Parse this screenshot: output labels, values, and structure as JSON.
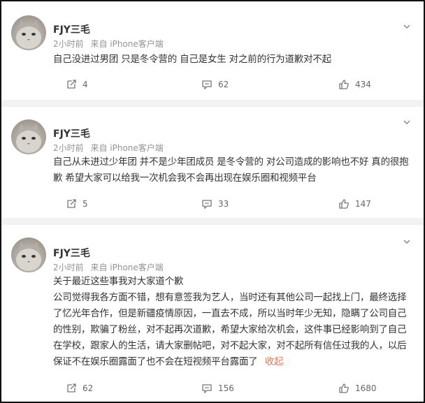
{
  "comments": [
    {
      "author": "FJY三毛",
      "time": "2小时前",
      "source": "来自 iPhone客户端",
      "lines": [
        "自己没进过男团 只是冬令营的 自己是女生 对之前的行为道歉对不起"
      ],
      "reposts": "4",
      "replies": "62",
      "likes": "434"
    },
    {
      "author": "FJY三毛",
      "time": "2小时前",
      "source": "来自 iPhone客户端",
      "lines": [
        "自己从未进过少年团 并不是少年团成员 是冬令营的 对公司造成的影响也不好 真的很抱",
        "歉 希望大家可以给我一次机会我不会再出现在娱乐圈和视频平台"
      ],
      "reposts": "5",
      "replies": "33",
      "likes": "147"
    },
    {
      "author": "FJY三毛",
      "time": "2小时前",
      "source": "来自 iPhone客户端",
      "lines": [
        "关于最近这些事我对大家道个歉",
        "公司觉得我各方面不错，想有意签我为艺人，当时还有其他公司一起找上门，最终选择",
        "了忆光年合作，但是新疆疫情原因，一直去不成，所以当时年少无知，隐瞒了公司自己",
        "的性别，欺骗了粉丝，对不起再次道歉，希望大家给次机会，这件事已经影响到了自己",
        "在学校，跟家人的生活，请大家删帖吧，对不起大家，对不起所有信任过我的人，以后",
        "保证不在娱乐圈露面了也不会在短视频平台露面了"
      ],
      "collapse_label": "收起",
      "reposts": "62",
      "replies": "156",
      "likes": "1680"
    }
  ],
  "icons": {
    "repost": "repost-icon",
    "comment": "comment-icon",
    "like": "thumbs-up-icon",
    "more": "chevron-down-icon"
  },
  "colors": {
    "accent": "#eb7350",
    "meta": "#939393",
    "separator": "#f2f2f2"
  }
}
